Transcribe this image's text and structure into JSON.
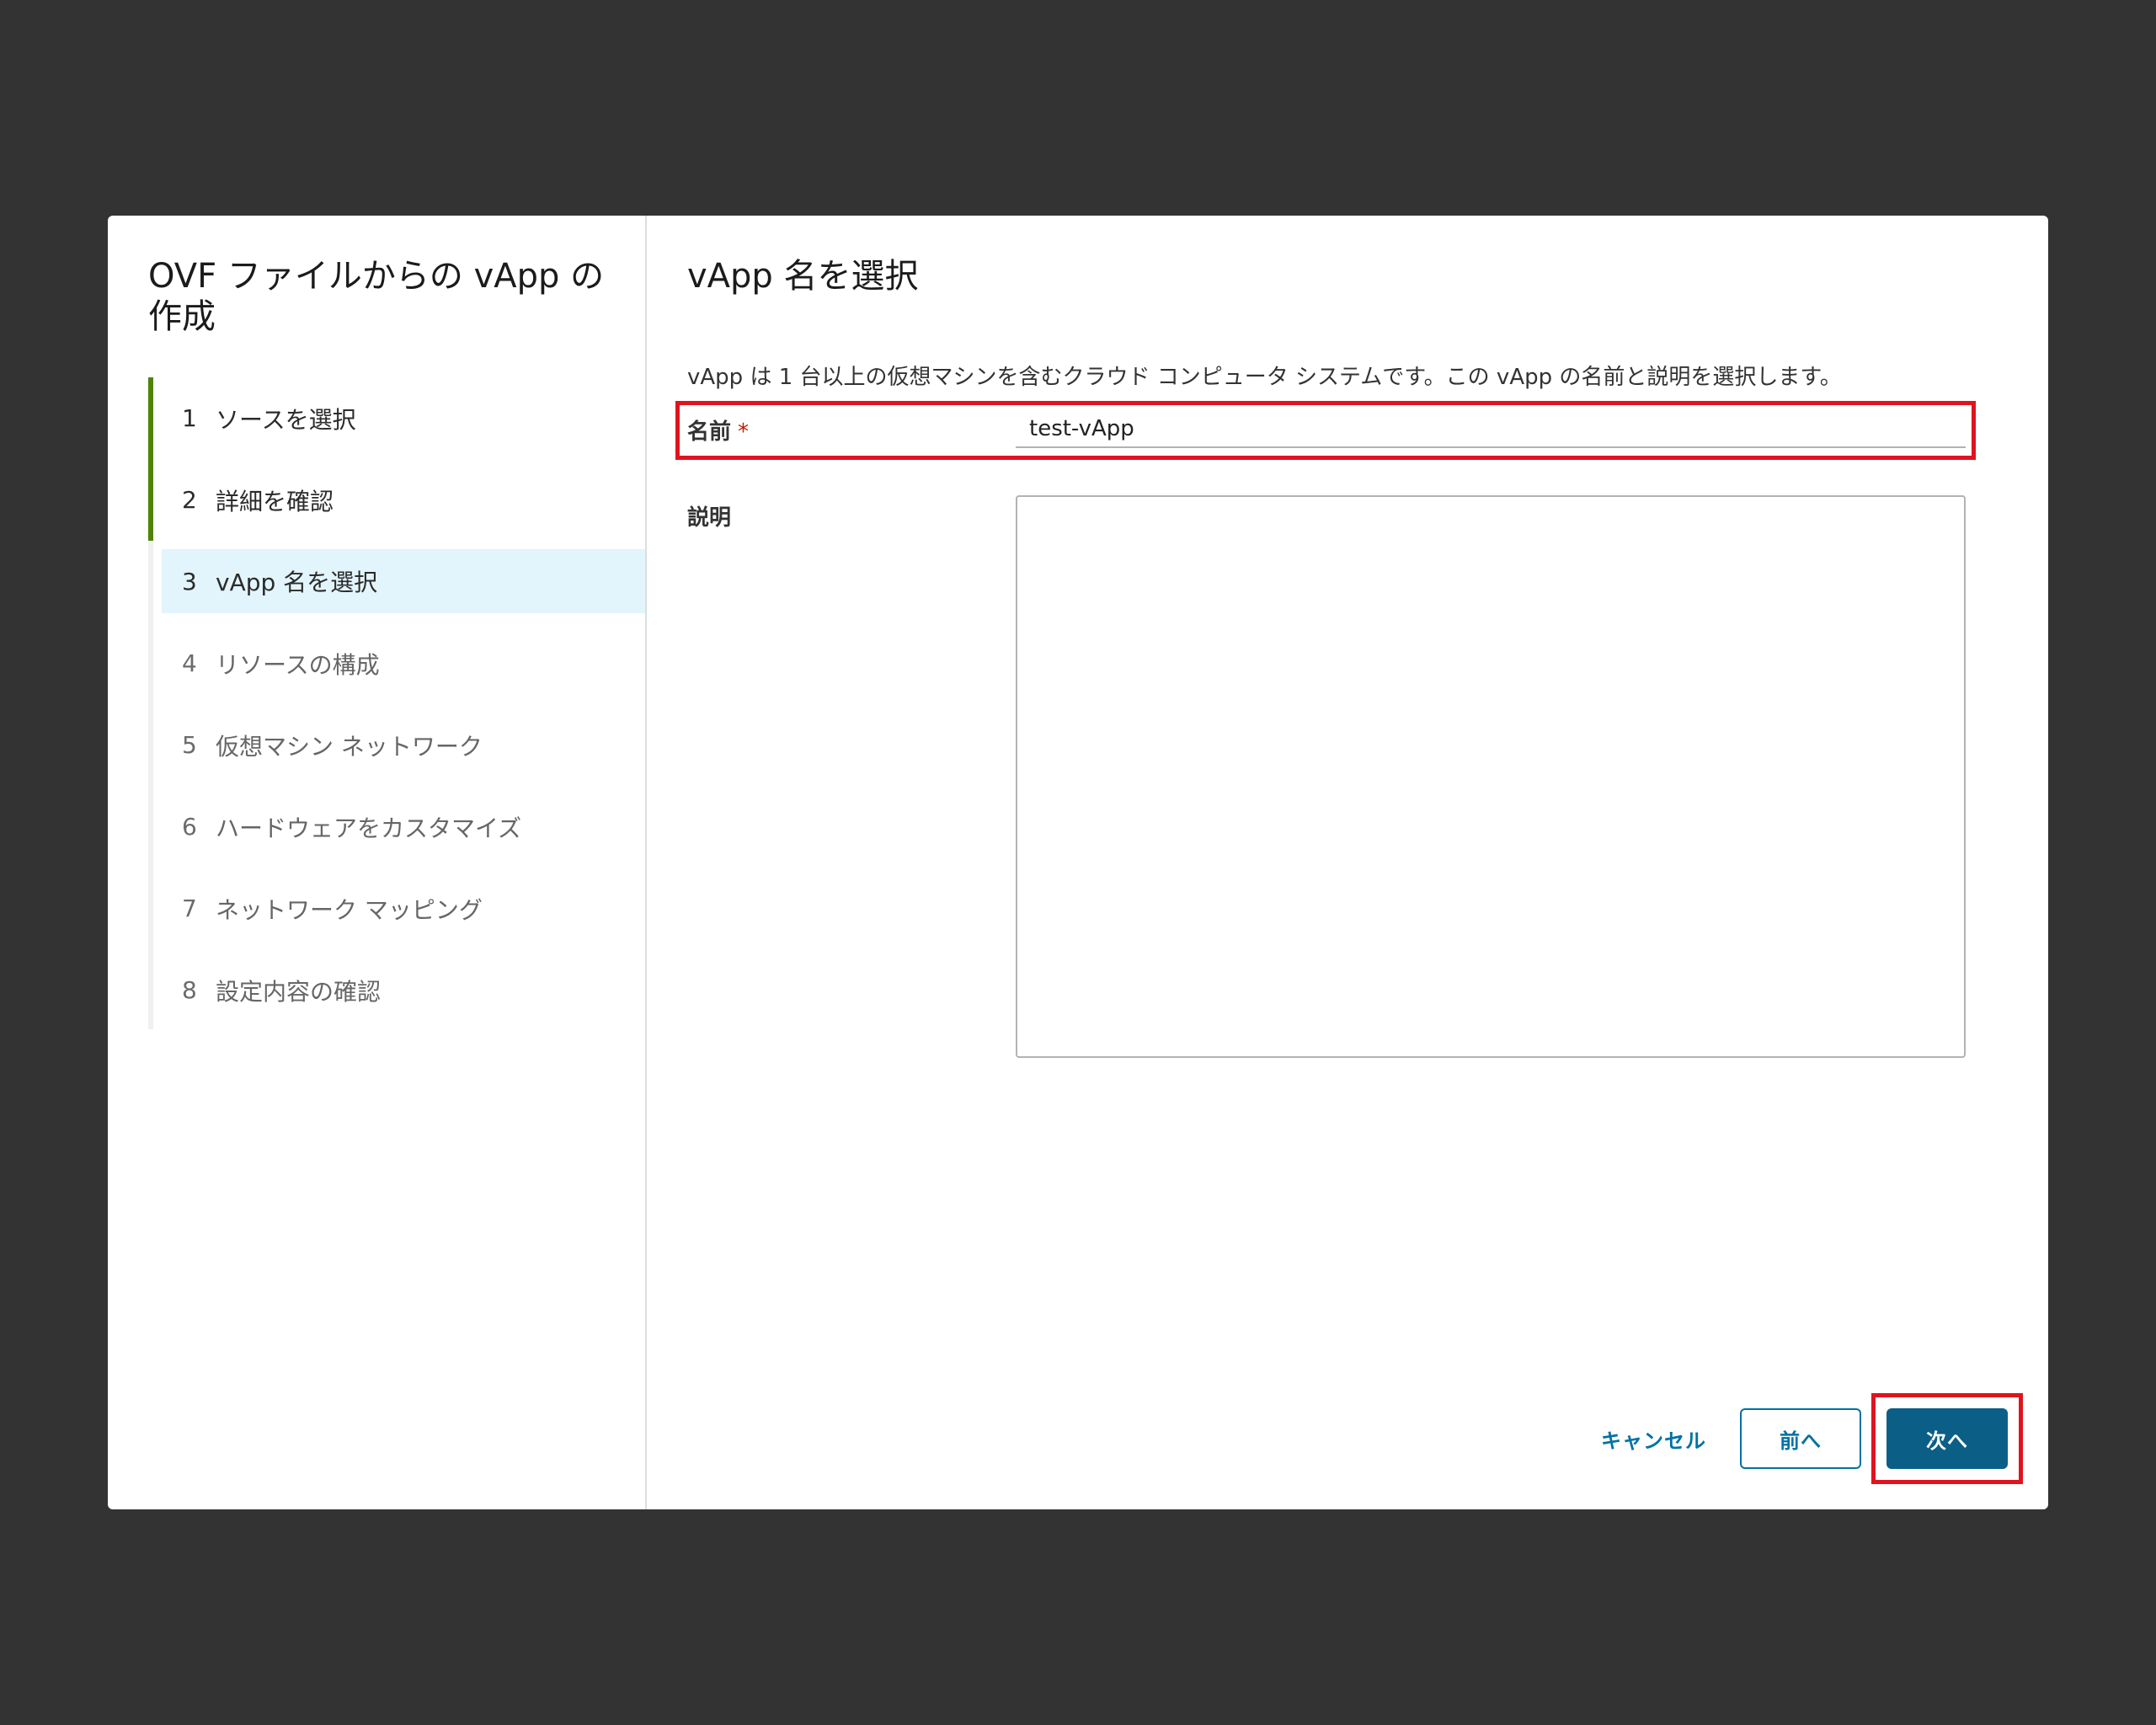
{
  "wizard": {
    "title": "OVF ファイルからの vApp の作成",
    "steps": [
      {
        "num": "1",
        "label": "ソースを選択",
        "state": "done"
      },
      {
        "num": "2",
        "label": "詳細を確認",
        "state": "done"
      },
      {
        "num": "3",
        "label": "vApp 名を選択",
        "state": "active"
      },
      {
        "num": "4",
        "label": "リソースの構成",
        "state": "pending"
      },
      {
        "num": "5",
        "label": "仮想マシン ネットワーク",
        "state": "pending"
      },
      {
        "num": "6",
        "label": "ハードウェアをカスタマイズ",
        "state": "pending"
      },
      {
        "num": "7",
        "label": "ネットワーク マッピング",
        "state": "pending"
      },
      {
        "num": "8",
        "label": "設定内容の確認",
        "state": "pending"
      }
    ]
  },
  "panel": {
    "title": "vApp 名を選択",
    "description": "vApp は 1 台以上の仮想マシンを含むクラウド コンピュータ システムです。この vApp の名前と説明を選択します。",
    "name_label": "名前",
    "name_required": "*",
    "name_value": "test-vApp",
    "description_label": "説明",
    "description_value": ""
  },
  "footer": {
    "cancel_label": "キャンセル",
    "back_label": "前へ",
    "next_label": "次へ"
  },
  "colors": {
    "overlay": "#333333",
    "progress_done": "#4f8400",
    "active_step_bg": "#e3f5fc",
    "primary": "#0b5f87",
    "link": "#0072a3",
    "highlight": "#e0141f"
  }
}
